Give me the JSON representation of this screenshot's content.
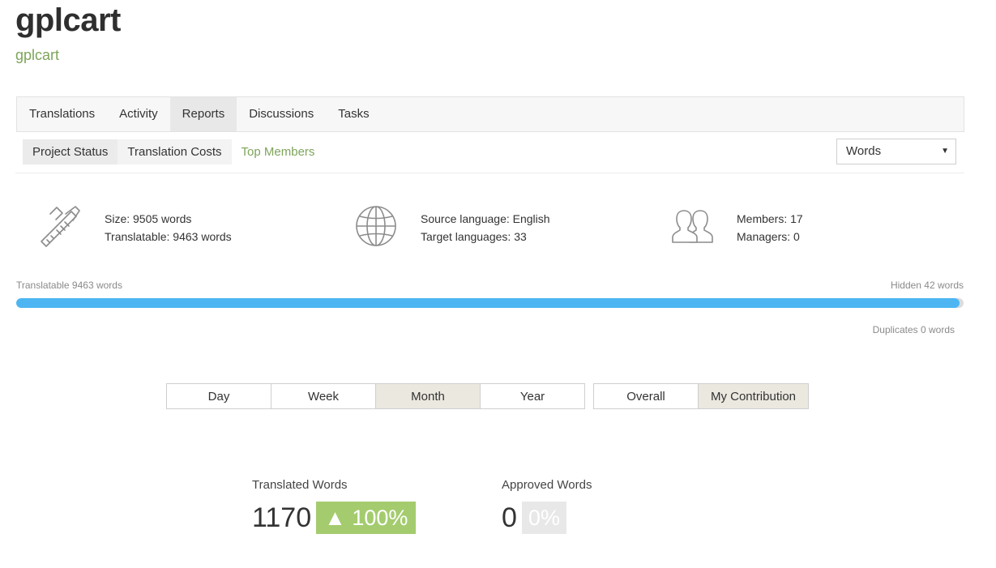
{
  "project": {
    "title": "gplcart",
    "subtitle": "gplcart"
  },
  "tabs": [
    {
      "label": "Translations"
    },
    {
      "label": "Activity"
    },
    {
      "label": "Reports",
      "active": true
    },
    {
      "label": "Discussions"
    },
    {
      "label": "Tasks"
    }
  ],
  "subtabs": [
    {
      "label": "Project Status",
      "active": true
    },
    {
      "label": "Translation Costs"
    },
    {
      "label": "Top Members"
    }
  ],
  "unit_select": {
    "value": "Words"
  },
  "stats": {
    "size": "Size: 9505 words",
    "translatable": "Translatable: 9463 words",
    "source_language": "Source language: English",
    "target_languages": "Target languages: 33",
    "members": "Members: 17",
    "managers": "Managers: 0"
  },
  "progress": {
    "left_label": "Translatable 9463 words",
    "right_label": "Hidden 42 words",
    "duplicates_label": "Duplicates 0 words",
    "fill_fraction": 0.9956
  },
  "periods": [
    {
      "label": "Day"
    },
    {
      "label": "Week"
    },
    {
      "label": "Month",
      "active": true
    },
    {
      "label": "Year"
    }
  ],
  "scope": [
    {
      "label": "Overall"
    },
    {
      "label": "My Contribution",
      "active": true
    }
  ],
  "metrics": {
    "translated": {
      "label": "Translated Words",
      "value": "1170",
      "badge": "▲ 100%"
    },
    "approved": {
      "label": "Approved Words",
      "value": "0",
      "badge": "0%"
    }
  },
  "colors": {
    "accent_green": "#7da45a",
    "progress_blue": "#4db6f2",
    "badge_green": "#a4cc6e"
  }
}
